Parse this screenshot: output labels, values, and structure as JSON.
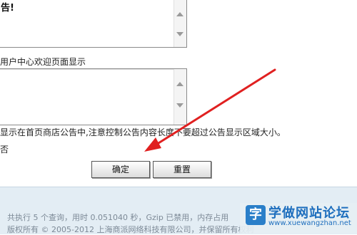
{
  "textarea_top": {
    "value": "告!"
  },
  "label_welcome": "用户中心欢迎页面显示",
  "textarea_mid": {
    "value": ""
  },
  "label_notice": "显示在首页商店公告中,注意控制公告内容长度不要超过公告显示区域大小。",
  "label_no": "否",
  "buttons": {
    "ok": "确定",
    "reset": "重置"
  },
  "footer": {
    "line1": "共执行 5 个查询，用时  0.051040 秒，Gzip 已禁用，内存占用",
    "line2": "版权所有 © 2005-2012 上海商派网络科技有限公司，并保留所有权利"
  },
  "watermark": {
    "mark": "字",
    "name": "学做网站论坛",
    "url": "www.xuewangzhan.net"
  },
  "colors": {
    "arrow": "#e02020",
    "footer_bg": "#e3edf4",
    "logo": "#1f6fbe"
  }
}
